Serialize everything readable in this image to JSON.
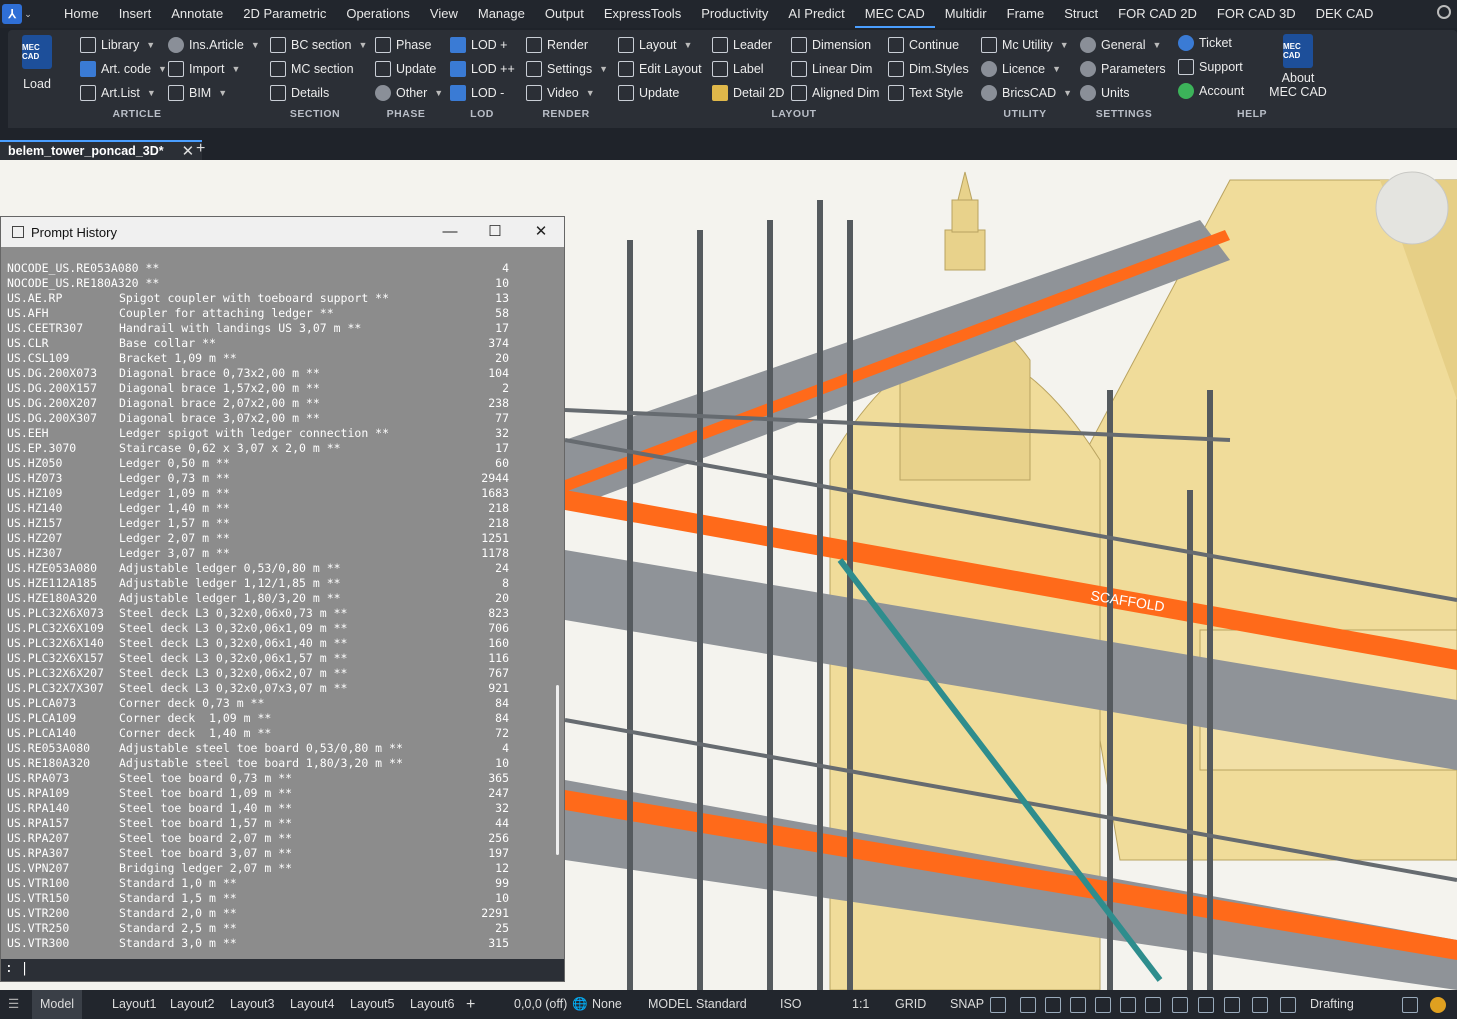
{
  "menubar": {
    "items": [
      "Home",
      "Insert",
      "Annotate",
      "2D Parametric",
      "Operations",
      "View",
      "Manage",
      "Output",
      "ExpressTools",
      "Productivity",
      "AI Predict",
      "MEC CAD",
      "Multidir",
      "Frame",
      "Struct",
      "FOR CAD 2D",
      "FOR CAD 3D",
      "DEK CAD"
    ],
    "active": "MEC CAD"
  },
  "ribbon": {
    "load": {
      "logo": "MEC CAD",
      "label": "Load"
    },
    "article": {
      "title": "ARTICLE",
      "items": [
        "Library",
        "Art. code",
        "Art.List"
      ]
    },
    "article2": {
      "items": [
        "Ins.Article",
        "Import",
        "BIM"
      ]
    },
    "section": {
      "title": "SECTION",
      "items": [
        "BC section",
        "MC section",
        "Details"
      ]
    },
    "phase": {
      "title": "PHASE",
      "items": [
        "Phase",
        "Update",
        "Other"
      ]
    },
    "lod": {
      "title": "LOD",
      "items": [
        "LOD +",
        "LOD ++",
        "LOD -"
      ]
    },
    "render": {
      "title": "RENDER",
      "items": [
        "Render",
        "Settings",
        "Video"
      ]
    },
    "layout": {
      "title": "LAYOUT",
      "col1": [
        "Layout",
        "Edit Layout",
        "Update"
      ],
      "col2": [
        "Leader",
        "Label",
        "Detail 2D"
      ],
      "col3": [
        "Dimension",
        "Linear Dim",
        "Aligned Dim"
      ],
      "col4": [
        "Continue",
        "Dim.Styles",
        "Text Style"
      ]
    },
    "utility": {
      "title": "UTILITY",
      "items": [
        "Mc Utility",
        "Licence",
        "BricsCAD"
      ]
    },
    "settings": {
      "title": "SETTINGS",
      "items": [
        "General",
        "Parameters",
        "Units"
      ]
    },
    "help": {
      "title": "HELP",
      "items": [
        "Ticket",
        "Support",
        "Account"
      ]
    },
    "about": {
      "logo": "MEC CAD",
      "label1": "About",
      "label2": "MEC CAD"
    }
  },
  "doc_tab": {
    "title": "belem_tower_poncad_3D*",
    "close": "✕",
    "add": "+"
  },
  "prompt_history": {
    "title": "Prompt History",
    "rows": [
      {
        "code": "NOCODE_US.RE053A080 **",
        "desc": "",
        "qty": "4"
      },
      {
        "code": "NOCODE_US.RE180A320 **",
        "desc": "",
        "qty": "10"
      },
      {
        "code": "US.AE.RP",
        "desc": "Spigot coupler with toeboard support **",
        "qty": "13"
      },
      {
        "code": "US.AFH",
        "desc": "Coupler for attaching ledger **",
        "qty": "58"
      },
      {
        "code": "US.CEETR307",
        "desc": "Handrail with landings US 3,07 m **",
        "qty": "17"
      },
      {
        "code": "US.CLR",
        "desc": "Base collar **",
        "qty": "374"
      },
      {
        "code": "US.CSL109",
        "desc": "Bracket 1,09 m **",
        "qty": "20"
      },
      {
        "code": "US.DG.200X073",
        "desc": "Diagonal brace 0,73x2,00 m **",
        "qty": "104"
      },
      {
        "code": "US.DG.200X157",
        "desc": "Diagonal brace 1,57x2,00 m **",
        "qty": "2"
      },
      {
        "code": "US.DG.200X207",
        "desc": "Diagonal brace 2,07x2,00 m **",
        "qty": "238"
      },
      {
        "code": "US.DG.200X307",
        "desc": "Diagonal brace 3,07x2,00 m **",
        "qty": "77"
      },
      {
        "code": "US.EEH",
        "desc": "Ledger spigot with ledger connection **",
        "qty": "32"
      },
      {
        "code": "US.EP.3070",
        "desc": "Staircase 0,62 x 3,07 x 2,0 m **",
        "qty": "17"
      },
      {
        "code": "US.HZ050",
        "desc": "Ledger 0,50 m **",
        "qty": "60"
      },
      {
        "code": "US.HZ073",
        "desc": "Ledger 0,73 m **",
        "qty": "2944"
      },
      {
        "code": "US.HZ109",
        "desc": "Ledger 1,09 m **",
        "qty": "1683"
      },
      {
        "code": "US.HZ140",
        "desc": "Ledger 1,40 m **",
        "qty": "218"
      },
      {
        "code": "US.HZ157",
        "desc": "Ledger 1,57 m **",
        "qty": "218"
      },
      {
        "code": "US.HZ207",
        "desc": "Ledger 2,07 m **",
        "qty": "1251"
      },
      {
        "code": "US.HZ307",
        "desc": "Ledger 3,07 m **",
        "qty": "1178"
      },
      {
        "code": "US.HZE053A080",
        "desc": "Adjustable ledger 0,53/0,80 m **",
        "qty": "24"
      },
      {
        "code": "US.HZE112A185",
        "desc": "Adjustable ledger 1,12/1,85 m **",
        "qty": "8"
      },
      {
        "code": "US.HZE180A320",
        "desc": "Adjustable ledger 1,80/3,20 m **",
        "qty": "20"
      },
      {
        "code": "US.PLC32X6X073",
        "desc": "Steel deck L3 0,32x0,06x0,73 m **",
        "qty": "823"
      },
      {
        "code": "US.PLC32X6X109",
        "desc": "Steel deck L3 0,32x0,06x1,09 m **",
        "qty": "706"
      },
      {
        "code": "US.PLC32X6X140",
        "desc": "Steel deck L3 0,32x0,06x1,40 m **",
        "qty": "160"
      },
      {
        "code": "US.PLC32X6X157",
        "desc": "Steel deck L3 0,32x0,06x1,57 m **",
        "qty": "116"
      },
      {
        "code": "US.PLC32X6X207",
        "desc": "Steel deck L3 0,32x0,06x2,07 m **",
        "qty": "767"
      },
      {
        "code": "US.PLC32X7X307",
        "desc": "Steel deck L3 0,32x0,07x3,07 m **",
        "qty": "921"
      },
      {
        "code": "US.PLCA073",
        "desc": "Corner deck 0,73 m **",
        "qty": "84"
      },
      {
        "code": "US.PLCA109",
        "desc": "Corner deck  1,09 m **",
        "qty": "84"
      },
      {
        "code": "US.PLCA140",
        "desc": "Corner deck  1,40 m **",
        "qty": "72"
      },
      {
        "code": "US.RE053A080",
        "desc": "Adjustable steel toe board 0,53/0,80 m **",
        "qty": "4"
      },
      {
        "code": "US.RE180A320",
        "desc": "Adjustable steel toe board 1,80/3,20 m **",
        "qty": "10"
      },
      {
        "code": "US.RPA073",
        "desc": "Steel toe board 0,73 m **",
        "qty": "365"
      },
      {
        "code": "US.RPA109",
        "desc": "Steel toe board 1,09 m **",
        "qty": "247"
      },
      {
        "code": "US.RPA140",
        "desc": "Steel toe board 1,40 m **",
        "qty": "32"
      },
      {
        "code": "US.RPA157",
        "desc": "Steel toe board 1,57 m **",
        "qty": "44"
      },
      {
        "code": "US.RPA207",
        "desc": "Steel toe board 2,07 m **",
        "qty": "256"
      },
      {
        "code": "US.RPA307",
        "desc": "Steel toe board 3,07 m **",
        "qty": "197"
      },
      {
        "code": "US.VPN207",
        "desc": "Bridging ledger 2,07 m **",
        "qty": "12"
      },
      {
        "code": "US.VTR100",
        "desc": "Standard 1,0 m **",
        "qty": "99"
      },
      {
        "code": "US.VTR150",
        "desc": "Standard 1,5 m **",
        "qty": "10"
      },
      {
        "code": "US.VTR200",
        "desc": "Standard 2,0 m **",
        "qty": "2291"
      },
      {
        "code": "US.VTR250",
        "desc": "Standard 2,5 m **",
        "qty": "25"
      },
      {
        "code": "US.VTR300",
        "desc": "Standard 3,0 m **",
        "qty": "315"
      }
    ],
    "input_prompt": ": |"
  },
  "viewport": {
    "labels": [
      "SCAFFOLD"
    ],
    "colors": {
      "bg": "#f4f3ee",
      "tower": "#f0dc9a",
      "tower_shade": "#d9c278",
      "steel": "#555a5e",
      "toeboard": "#ff6a1a",
      "diagonal": "#2e8d8d",
      "deck": "#8f9398"
    }
  },
  "statusbar": {
    "tabs": [
      "Model",
      "Layout1",
      "Layout2",
      "Layout3",
      "Layout4",
      "Layout5",
      "Layout6"
    ],
    "add": "+",
    "coords": "0,0,0 (off)",
    "none": "None",
    "model": "MODEL",
    "standard": "Standard",
    "iso": "ISO",
    "scale": "1:1",
    "grid": "GRID",
    "snap": "SNAP",
    "workspace": "Drafting"
  }
}
